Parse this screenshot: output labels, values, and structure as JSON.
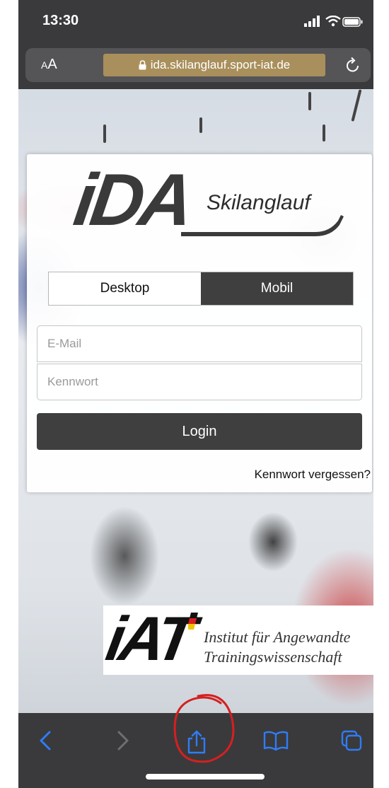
{
  "status_bar": {
    "time": "13:30"
  },
  "address_bar": {
    "text_size_small": "A",
    "text_size_large": "A",
    "url": "ida.skilanglauf.sport-iat.de"
  },
  "login_card": {
    "logo_text": "iDA",
    "logo_subtitle": "Skilanglauf",
    "mode_toggle": {
      "options": [
        "Desktop",
        "Mobil"
      ],
      "selected": "Mobil"
    },
    "email_placeholder": "E-Mail",
    "password_placeholder": "Kennwort",
    "login_label": "Login",
    "forgot_label": "Kennwort vergessen?"
  },
  "iat_logo": {
    "letters": "iAT",
    "line1": "Institut für Angewandte",
    "line2": "Trainingswissenschaft"
  },
  "toolbar": {
    "items": [
      "back-icon",
      "forward-icon",
      "share-icon",
      "bookmarks-icon",
      "tabs-icon"
    ],
    "accent_color": "#2f7cf6",
    "disabled_color": "#6e6e73"
  },
  "colors": {
    "chrome": "#3a3a3c",
    "url_highlight": "#a98f5b",
    "annotation": "#d42020",
    "button_dark": "#3f3f3f"
  }
}
